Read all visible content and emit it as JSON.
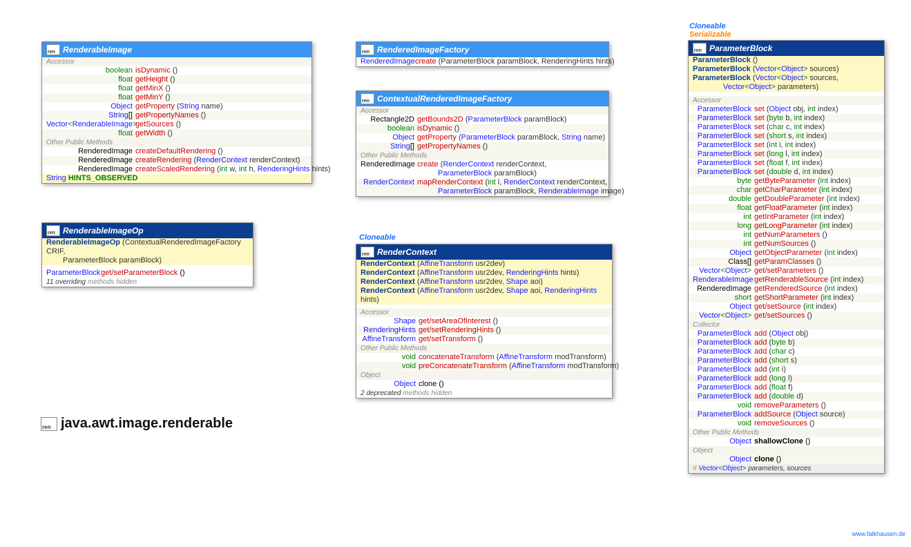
{
  "package": "java.awt.image.renderable",
  "credit": "www.falkhausen.de",
  "interfaces": {
    "cloneable": "Cloneable",
    "serializable": "Serializable"
  },
  "renderableImage": {
    "title": "RenderableImage",
    "sections": {
      "accessor": "Accessor",
      "other": "Other Public Methods"
    },
    "accessor": [
      {
        "ret": "boolean",
        "m": "isDynamic",
        "p": "()"
      },
      {
        "ret": "float",
        "m": "getHeight",
        "p": "()"
      },
      {
        "ret": "float",
        "m": "getMinX",
        "p": "()"
      },
      {
        "ret": "float",
        "m": "getMinY",
        "p": "()"
      },
      {
        "ret": "Object",
        "rt": "type",
        "m": "getProperty",
        "p": "(String name)"
      },
      {
        "ret": "String[]",
        "rt": "type",
        "m": "getPropertyNames",
        "p": "()"
      },
      {
        "ret": "Vector<RenderableImage>",
        "rt": "type",
        "m": "getSources",
        "p": "()"
      },
      {
        "ret": "float",
        "m": "getWidth",
        "p": "()"
      }
    ],
    "other": [
      {
        "ret": "RenderedImage",
        "rt": "type",
        "m": "createDefaultRendering",
        "p": "()"
      },
      {
        "ret": "RenderedImage",
        "rt": "type",
        "m": "createRendering",
        "p": "(RenderContext renderContext)"
      },
      {
        "ret": "RenderedImage",
        "rt": "type",
        "m": "createScaledRendering",
        "p": "(int w, int h, RenderingHints hints)"
      }
    ],
    "constant": {
      "ret": "String",
      "name": "HINTS_OBSERVED"
    }
  },
  "renderableImageOp": {
    "title": "RenderableImageOp",
    "ctor": {
      "name": "RenderableImageOp",
      "p": "(ContextualRenderedImageFactory CRIF,",
      "p2": "ParameterBlock paramBlock)"
    },
    "row": {
      "ret": "ParameterBlock",
      "m": "get/setParameterBlock",
      "p": "()"
    },
    "footer": "11 overriding methods hidden"
  },
  "renderedImageFactory": {
    "title": "RenderedImageFactory",
    "row": {
      "ret": "RenderedImage",
      "m": "create",
      "p": "(ParameterBlock paramBlock, RenderingHints hints)"
    }
  },
  "contextualFactory": {
    "title": "ContextualRenderedImageFactory",
    "section_accessor": "Accessor",
    "section_other": "Other Public Methods",
    "accessor": [
      {
        "ret": "Rectangle2D",
        "rt": "type",
        "m": "getBounds2D",
        "p": "(ParameterBlock paramBlock)"
      },
      {
        "ret": "boolean",
        "m": "isDynamic",
        "p": "()"
      },
      {
        "ret": "Object",
        "rt": "type",
        "m": "getProperty",
        "p": "(ParameterBlock paramBlock, String name)"
      },
      {
        "ret": "String[]",
        "rt": "type",
        "m": "getPropertyNames",
        "p": "()"
      }
    ],
    "other": [
      {
        "ret": "RenderedImage",
        "rt": "type",
        "m": "create",
        "p": "(RenderContext renderContext,",
        "p2": "ParameterBlock paramBlock)"
      },
      {
        "ret": "RenderContext",
        "rt": "type",
        "m": "mapRenderContext",
        "p": "(int i, RenderContext renderContext,",
        "p2": "ParameterBlock paramBlock, RenderableImage image)"
      }
    ]
  },
  "renderContext": {
    "title": "RenderContext",
    "ctors": [
      {
        "name": "RenderContext",
        "p": "(AffineTransform usr2dev)"
      },
      {
        "name": "RenderContext",
        "p": "(AffineTransform usr2dev, RenderingHints hints)"
      },
      {
        "name": "RenderContext",
        "p": "(AffineTransform usr2dev, Shape aoi)"
      },
      {
        "name": "RenderContext",
        "p": "(AffineTransform usr2dev, Shape aoi, RenderingHints hints)"
      }
    ],
    "section_accessor": "Accessor",
    "accessor": [
      {
        "ret": "Shape",
        "rt": "type",
        "m": "get/setAreaOfInterest",
        "p": "()"
      },
      {
        "ret": "RenderingHints",
        "rt": "type",
        "m": "get/setRenderingHints",
        "p": "()"
      },
      {
        "ret": "AffineTransform",
        "rt": "type",
        "m": "get/setTransform",
        "p": "()"
      }
    ],
    "section_other": "Other Public Methods",
    "other": [
      {
        "ret": "void",
        "m": "concatenateTransform",
        "p": "(AffineTransform modTransform)"
      },
      {
        "ret": "void",
        "m": "preConcatenateTransform",
        "p": "(AffineTransform modTransform)"
      }
    ],
    "section_object": "Object",
    "obj": {
      "ret": "Object",
      "m": "clone",
      "p": "()"
    },
    "footer": "2 deprecated methods hidden"
  },
  "parameterBlock": {
    "title": "ParameterBlock",
    "ctors": [
      {
        "name": "ParameterBlock",
        "p": "()"
      },
      {
        "name": "ParameterBlock",
        "p": "(Vector<Object> sources)"
      },
      {
        "name": "ParameterBlock",
        "p": "(Vector<Object> sources,",
        "p2": "Vector<Object> parameters)"
      }
    ],
    "section_accessor": "Accessor",
    "accessor": [
      {
        "ret": "ParameterBlock",
        "rt": "type",
        "m": "set",
        "p": "(Object obj, int index)"
      },
      {
        "ret": "ParameterBlock",
        "rt": "type",
        "m": "set",
        "p": "(byte b, int index)"
      },
      {
        "ret": "ParameterBlock",
        "rt": "type",
        "m": "set",
        "p": "(char c, int index)"
      },
      {
        "ret": "ParameterBlock",
        "rt": "type",
        "m": "set",
        "p": "(short s, int index)"
      },
      {
        "ret": "ParameterBlock",
        "rt": "type",
        "m": "set",
        "p": "(int i, int index)"
      },
      {
        "ret": "ParameterBlock",
        "rt": "type",
        "m": "set",
        "p": "(long l, int index)"
      },
      {
        "ret": "ParameterBlock",
        "rt": "type",
        "m": "set",
        "p": "(float f, int index)"
      },
      {
        "ret": "ParameterBlock",
        "rt": "type",
        "m": "set",
        "p": "(double d, int index)"
      },
      {
        "ret": "byte",
        "m": "getByteParameter",
        "p": "(int index)"
      },
      {
        "ret": "char",
        "m": "getCharParameter",
        "p": "(int index)"
      },
      {
        "ret": "double",
        "m": "getDoubleParameter",
        "p": "(int index)"
      },
      {
        "ret": "float",
        "m": "getFloatParameter",
        "p": "(int index)"
      },
      {
        "ret": "int",
        "m": "getIntParameter",
        "p": "(int index)"
      },
      {
        "ret": "long",
        "m": "getLongParameter",
        "p": "(int index)"
      },
      {
        "ret": "int",
        "m": "getNumParameters",
        "p": "()"
      },
      {
        "ret": "int",
        "m": "getNumSources",
        "p": "()"
      },
      {
        "ret": "Object",
        "rt": "type",
        "m": "getObjectParameter",
        "p": "(int index)"
      },
      {
        "ret": "Class[]",
        "rt": "type",
        "m": "getParamClasses",
        "p": "()"
      },
      {
        "ret": "Vector<Object>",
        "rt": "type",
        "m": "get/setParameters",
        "p": "()"
      },
      {
        "ret": "RenderableImage",
        "rt": "type",
        "m": "getRenderableSource",
        "p": "(int index)"
      },
      {
        "ret": "RenderedImage",
        "rt": "type",
        "m": "getRenderedSource",
        "p": "(int index)"
      },
      {
        "ret": "short",
        "m": "getShortParameter",
        "p": "(int index)"
      },
      {
        "ret": "Object",
        "rt": "type",
        "m": "get/setSource",
        "p": "(int index)"
      },
      {
        "ret": "Vector<Object>",
        "rt": "type",
        "m": "get/setSources",
        "p": "()"
      }
    ],
    "section_collector": "Collector",
    "collector": [
      {
        "ret": "ParameterBlock",
        "rt": "type",
        "m": "add",
        "p": "(Object obj)"
      },
      {
        "ret": "ParameterBlock",
        "rt": "type",
        "m": "add",
        "p": "(byte b)"
      },
      {
        "ret": "ParameterBlock",
        "rt": "type",
        "m": "add",
        "p": "(char c)"
      },
      {
        "ret": "ParameterBlock",
        "rt": "type",
        "m": "add",
        "p": "(short s)"
      },
      {
        "ret": "ParameterBlock",
        "rt": "type",
        "m": "add",
        "p": "(int i)"
      },
      {
        "ret": "ParameterBlock",
        "rt": "type",
        "m": "add",
        "p": "(long l)"
      },
      {
        "ret": "ParameterBlock",
        "rt": "type",
        "m": "add",
        "p": "(float f)"
      },
      {
        "ret": "ParameterBlock",
        "rt": "type",
        "m": "add",
        "p": "(double d)"
      },
      {
        "ret": "void",
        "m": "removeParameters",
        "p": "()"
      },
      {
        "ret": "ParameterBlock",
        "rt": "type",
        "m": "addSource",
        "p": "(Object source)"
      },
      {
        "ret": "void",
        "m": "removeSources",
        "p": "()"
      }
    ],
    "section_other": "Other Public Methods",
    "other": {
      "ret": "Object",
      "rt": "type",
      "m": "shallowClone",
      "p": "()"
    },
    "section_object": "Object",
    "obj": {
      "ret": "Object",
      "rt": "type",
      "m": "clone",
      "p": "()"
    },
    "footer": "# Vector<Object> parameters, sources"
  }
}
